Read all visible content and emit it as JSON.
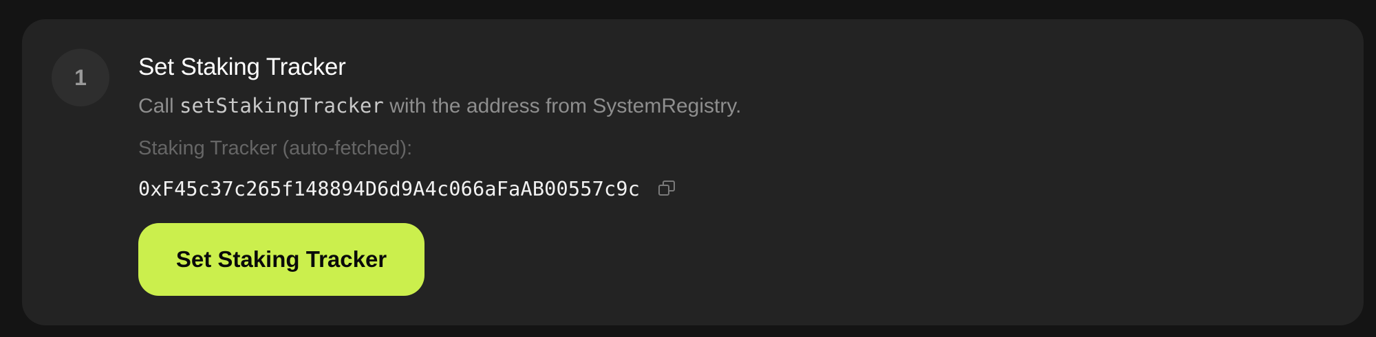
{
  "step": {
    "number": "1",
    "title": "Set Staking Tracker",
    "description_prefix": "Call",
    "description_code": "setStakingTracker",
    "description_suffix": "with the address from SystemRegistry.",
    "field_label": "Staking Tracker (auto-fetched):",
    "address": "0xF45c37c265f148894D6d9A4c066aFaAB00557c9c",
    "button_label": "Set Staking Tracker"
  },
  "colors": {
    "page_background": "#141414",
    "card_background": "#232323",
    "accent": "#cbef4d"
  },
  "icons": {
    "copy": "copy-icon"
  }
}
